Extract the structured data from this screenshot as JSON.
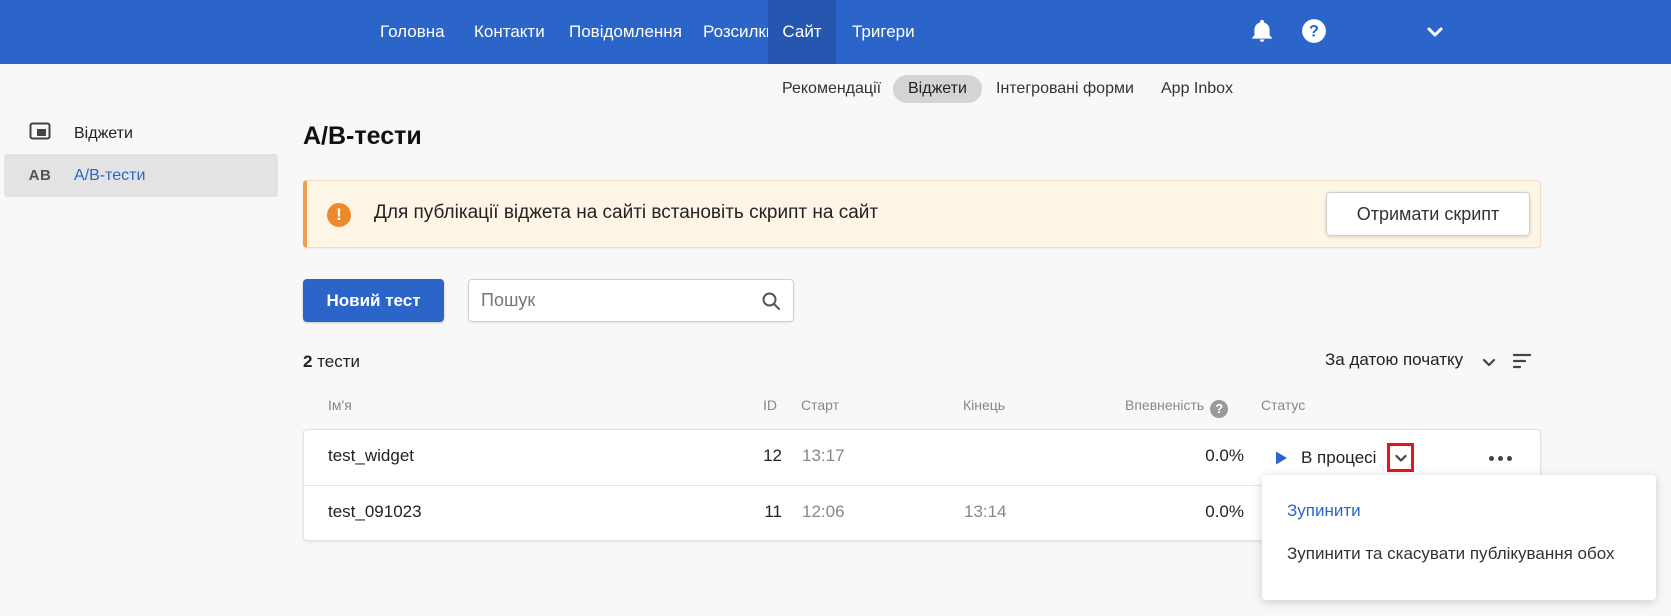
{
  "nav": {
    "items": [
      {
        "label": "Головна",
        "active": false
      },
      {
        "label": "Контакти",
        "active": false
      },
      {
        "label": "Повідомлення",
        "active": false
      },
      {
        "label": "Розсилки",
        "active": false
      },
      {
        "label": "Сайт",
        "active": true
      },
      {
        "label": "Тригери",
        "active": false
      }
    ],
    "icons": [
      "bell-icon",
      "help-circle-icon",
      "chevron-down-icon"
    ]
  },
  "subnav": {
    "items": [
      {
        "label": "Рекомендації",
        "active": false
      },
      {
        "label": "Віджети",
        "active": true
      },
      {
        "label": "Інтегровані форми",
        "active": false
      },
      {
        "label": "App Inbox",
        "active": false
      }
    ]
  },
  "sidebar": {
    "items": [
      {
        "label": "Віджети",
        "icon": "widget-icon",
        "active": false
      },
      {
        "label": "А/В-тести",
        "badge": "AB",
        "active": true
      }
    ]
  },
  "page": {
    "title": "А/В-тести"
  },
  "banner": {
    "text": "Для публікації віджета на сайті встановіть скрипт на сайт",
    "button": "Отримати скрипт",
    "icon": "warning-icon",
    "color": "#f0a04b"
  },
  "toolbar": {
    "new_button": "Новий тест",
    "search_placeholder": "Пошук"
  },
  "list": {
    "count": "2",
    "count_label": "тести",
    "sort_label": "За датою початку"
  },
  "table": {
    "headers": {
      "name": "Ім'я",
      "id": "ID",
      "start": "Старт",
      "end": "Кінець",
      "confidence": "Впевненість",
      "status": "Статус"
    },
    "rows": [
      {
        "name": "test_widget",
        "id": "12",
        "start": "13:17",
        "end": "",
        "confidence": "0.0%",
        "status": "В процесі"
      },
      {
        "name": "test_091023",
        "id": "11",
        "start": "12:06",
        "end": "13:14",
        "confidence": "0.0%",
        "status": ""
      }
    ]
  },
  "status_menu": {
    "items": [
      "Зупинити",
      "Зупинити та скасувати публікування обох"
    ]
  },
  "colors": {
    "primary": "#2b65c9",
    "highlight": "#e8141b"
  }
}
